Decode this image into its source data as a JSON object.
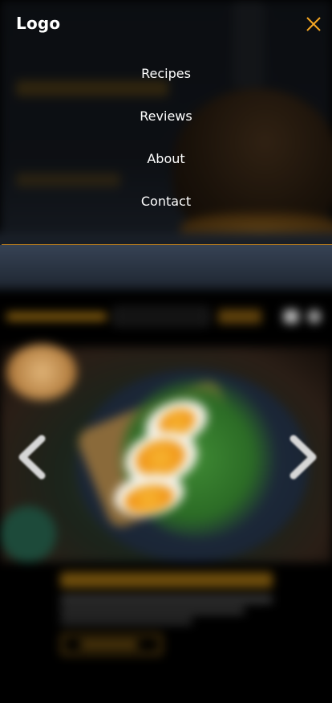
{
  "header": {
    "logo": "Logo",
    "close_icon": "close-icon"
  },
  "menu": {
    "items": [
      {
        "label": "Recipes"
      },
      {
        "label": "Reviews"
      },
      {
        "label": "About"
      },
      {
        "label": "Contact"
      }
    ]
  },
  "carousel": {
    "prev_icon": "chevron-left-icon",
    "next_icon": "chevron-right-icon"
  },
  "colors": {
    "accent": "#f5a623",
    "divider": "#c9871e",
    "overlay_text": "#ffffff",
    "background": "#000000"
  }
}
